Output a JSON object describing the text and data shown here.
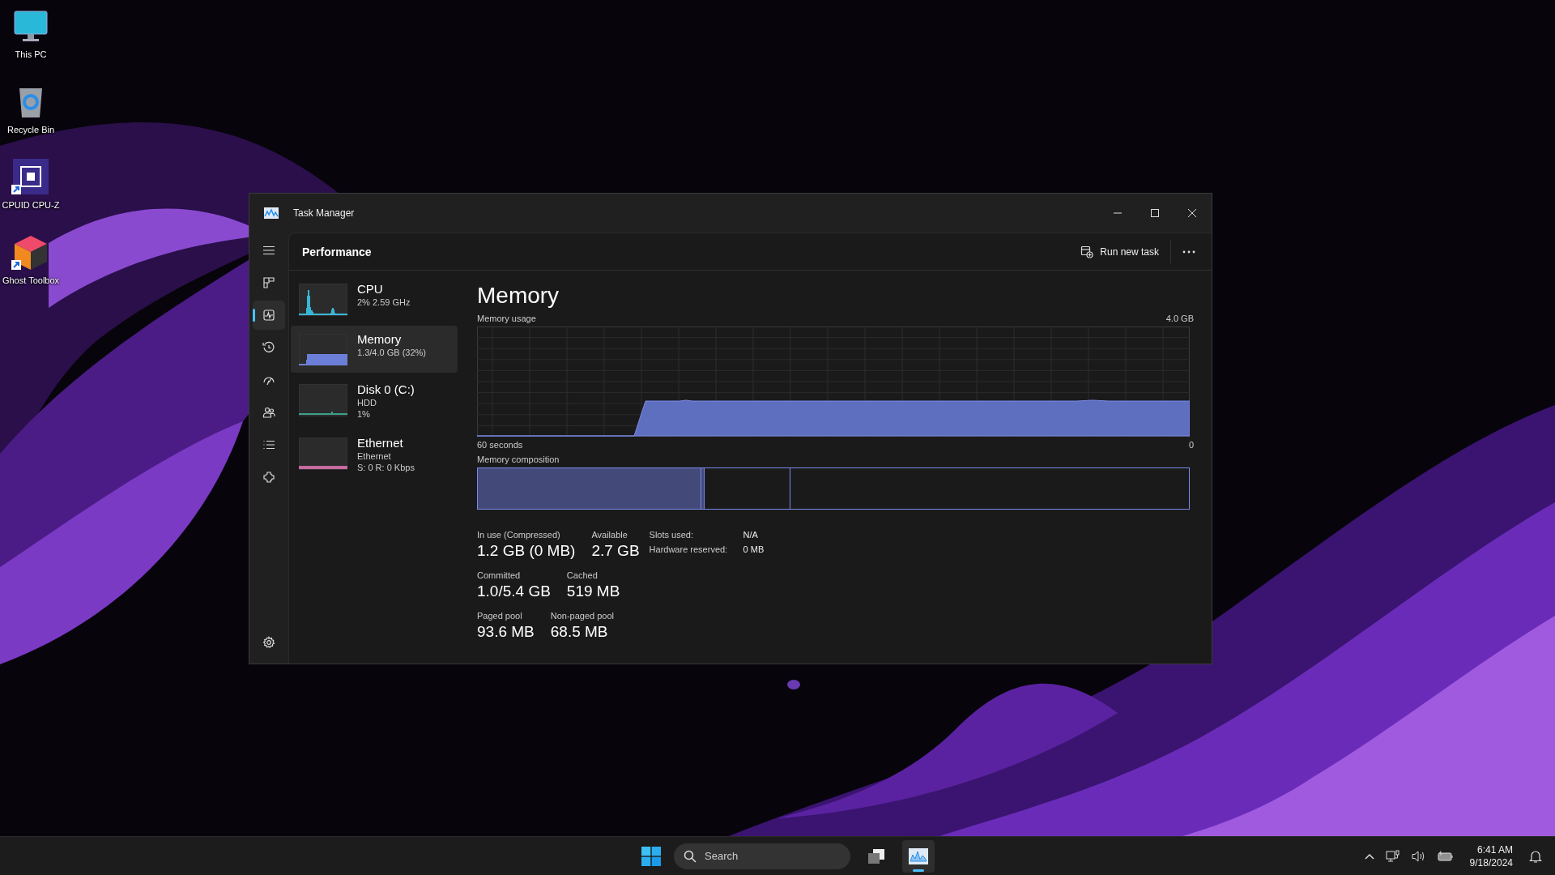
{
  "desktop_icons": [
    {
      "label": "This PC",
      "kind": "monitor",
      "shortcut": false
    },
    {
      "label": "Recycle Bin",
      "kind": "bin",
      "shortcut": false
    },
    {
      "label": "CPUID CPU-Z",
      "kind": "chip",
      "shortcut": true
    },
    {
      "label": "Ghost Toolbox",
      "kind": "cube",
      "shortcut": true
    }
  ],
  "window": {
    "title": "Task Manager"
  },
  "nav": [
    {
      "kind": "menu",
      "selected": false
    },
    {
      "kind": "processes",
      "selected": false
    },
    {
      "kind": "performance",
      "selected": true
    },
    {
      "kind": "history",
      "selected": false
    },
    {
      "kind": "startup",
      "selected": false
    },
    {
      "kind": "users",
      "selected": false
    },
    {
      "kind": "details",
      "selected": false
    },
    {
      "kind": "services",
      "selected": false
    },
    {
      "kind": "settings",
      "selected": false
    }
  ],
  "page": {
    "title": "Performance",
    "run_new_task": "Run new task"
  },
  "devices": [
    {
      "name": "CPU",
      "lines": [
        "2%  2.59 GHz"
      ],
      "kind": "cpu",
      "color": "#3ab5d6",
      "selected": false
    },
    {
      "name": "Memory",
      "lines": [
        "1.3/4.0 GB (32%)"
      ],
      "kind": "memory",
      "color": "#6c7fd8",
      "selected": true
    },
    {
      "name": "Disk 0 (C:)",
      "lines": [
        "HDD",
        "1%"
      ],
      "kind": "disk",
      "color": "#3aa08a",
      "selected": false
    },
    {
      "name": "Ethernet",
      "lines": [
        "Ethernet",
        "S: 0 R: 0 Kbps"
      ],
      "kind": "net",
      "color": "#c76aa0",
      "selected": false
    }
  ],
  "detail": {
    "title": "Memory",
    "usage_label": "Memory usage",
    "usage_max": "4.0 GB",
    "time_start": "60 seconds",
    "time_end": "0",
    "composition_label": "Memory composition",
    "stats": [
      [
        {
          "label": "In use (Compressed)",
          "value": "1.2 GB (0 MB)"
        },
        {
          "label": "Available",
          "value": "2.7 GB"
        }
      ],
      [
        {
          "label": "Committed",
          "value": "1.0/5.4 GB"
        },
        {
          "label": "Cached",
          "value": "519 MB"
        }
      ],
      [
        {
          "label": "Paged pool",
          "value": "93.6 MB"
        },
        {
          "label": "Non-paged pool",
          "value": "68.5 MB"
        }
      ]
    ],
    "info": [
      {
        "label": "Slots used:",
        "value": "N/A"
      },
      {
        "label": "Hardware reserved:",
        "value": "0 MB"
      }
    ]
  },
  "taskbar": {
    "search_placeholder": "Search",
    "apps": [
      {
        "kind": "task-view",
        "active": false
      },
      {
        "kind": "task-manager",
        "active": true
      }
    ],
    "time": "6:41 AM",
    "date": "9/18/2024"
  }
}
